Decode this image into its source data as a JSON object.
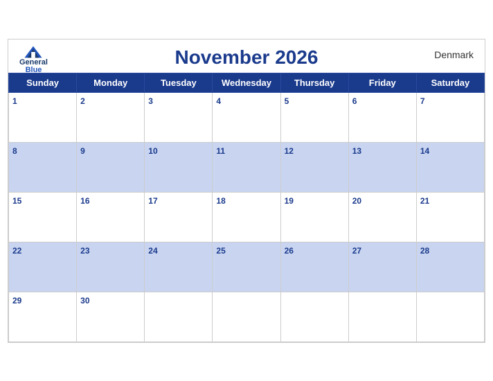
{
  "header": {
    "title": "November 2026",
    "country": "Denmark",
    "logo": {
      "general": "General",
      "blue": "Blue"
    }
  },
  "weekdays": [
    "Sunday",
    "Monday",
    "Tuesday",
    "Wednesday",
    "Thursday",
    "Friday",
    "Saturday"
  ],
  "weeks": [
    [
      {
        "num": "1",
        "empty": false
      },
      {
        "num": "2",
        "empty": false
      },
      {
        "num": "3",
        "empty": false
      },
      {
        "num": "4",
        "empty": false
      },
      {
        "num": "5",
        "empty": false
      },
      {
        "num": "6",
        "empty": false
      },
      {
        "num": "7",
        "empty": false
      }
    ],
    [
      {
        "num": "8",
        "empty": false
      },
      {
        "num": "9",
        "empty": false
      },
      {
        "num": "10",
        "empty": false
      },
      {
        "num": "11",
        "empty": false
      },
      {
        "num": "12",
        "empty": false
      },
      {
        "num": "13",
        "empty": false
      },
      {
        "num": "14",
        "empty": false
      }
    ],
    [
      {
        "num": "15",
        "empty": false
      },
      {
        "num": "16",
        "empty": false
      },
      {
        "num": "17",
        "empty": false
      },
      {
        "num": "18",
        "empty": false
      },
      {
        "num": "19",
        "empty": false
      },
      {
        "num": "20",
        "empty": false
      },
      {
        "num": "21",
        "empty": false
      }
    ],
    [
      {
        "num": "22",
        "empty": false
      },
      {
        "num": "23",
        "empty": false
      },
      {
        "num": "24",
        "empty": false
      },
      {
        "num": "25",
        "empty": false
      },
      {
        "num": "26",
        "empty": false
      },
      {
        "num": "27",
        "empty": false
      },
      {
        "num": "28",
        "empty": false
      }
    ],
    [
      {
        "num": "29",
        "empty": false
      },
      {
        "num": "30",
        "empty": false
      },
      {
        "num": "",
        "empty": true
      },
      {
        "num": "",
        "empty": true
      },
      {
        "num": "",
        "empty": true
      },
      {
        "num": "",
        "empty": true
      },
      {
        "num": "",
        "empty": true
      }
    ]
  ]
}
